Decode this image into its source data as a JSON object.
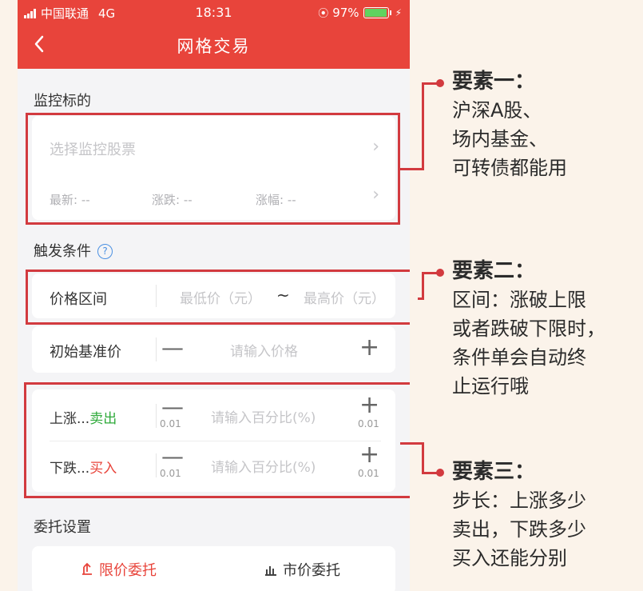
{
  "status_bar": {
    "carrier": "中国联通",
    "network": "4G",
    "time": "18:31",
    "battery": "97%",
    "battery_level": 0.97
  },
  "nav": {
    "back_icon": "chevron-left-icon",
    "title": "网格交易"
  },
  "monitor": {
    "section_title": "监控标的",
    "select_placeholder": "选择监控股票",
    "latest_label": "最新: --",
    "change_label": "涨跌: --",
    "change_pct_label": "涨幅: --"
  },
  "trigger": {
    "section_title": "触发条件",
    "price_range_label": "价格区间",
    "min_price_placeholder": "最低价（元）",
    "tilde": "~",
    "max_price_placeholder": "最高价（元）",
    "base_price_label": "初始基准价",
    "base_price_placeholder": "请输入价格"
  },
  "steps": {
    "rise_label_prefix": "上涨...",
    "rise_action": "卖出",
    "fall_label_prefix": "下跌...",
    "fall_action": "买入",
    "pct_placeholder": "请输入百分比(%)",
    "step_value": "0.01"
  },
  "order": {
    "section_title": "委托设置",
    "limit_label": "限价委托",
    "market_label": "市价委托"
  },
  "annotations": [
    {
      "head": "要素一：",
      "lines": [
        "沪深A股、",
        "场内基金、",
        "可转债都能用"
      ]
    },
    {
      "head": "要素二：",
      "lines": [
        "区间：涨破上限",
        "或者跌破下限时，",
        "条件单会自动终",
        "止运行哦"
      ]
    },
    {
      "head": "要素三：",
      "lines": [
        "步长：上涨多少",
        "卖出，下跌多少",
        "买入还能分别"
      ]
    }
  ],
  "colors": {
    "brand_red": "#e8443b",
    "annotation_red": "#d23a3f",
    "sell_green": "#2eaa3a",
    "buy_red": "#e8443b",
    "help_blue": "#4a90e2"
  }
}
